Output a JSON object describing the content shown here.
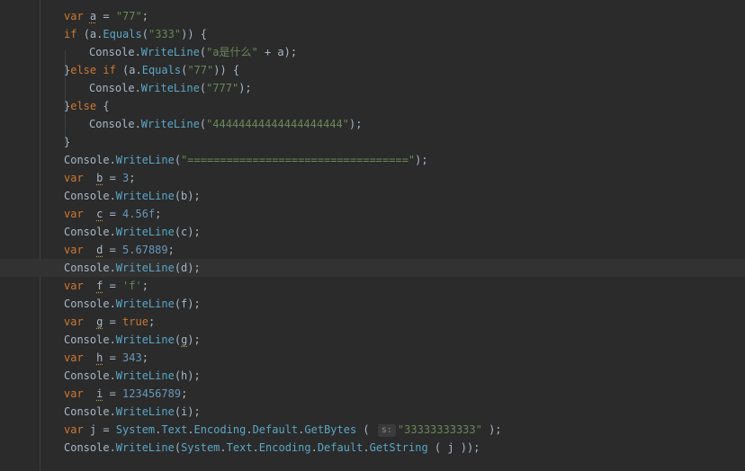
{
  "editor": {
    "lines": [
      {
        "indent": 0,
        "parts": [
          [
            "kw",
            "var "
          ],
          [
            "warn",
            "a"
          ],
          [
            "plain",
            " = "
          ],
          [
            "str",
            "\"77\""
          ],
          [
            "plain",
            ";"
          ]
        ]
      },
      {
        "indent": 0,
        "parts": [
          [
            "kw",
            "if "
          ],
          [
            "plain",
            "(a."
          ],
          [
            "fn",
            "Equals"
          ],
          [
            "plain",
            "("
          ],
          [
            "str",
            "\"333\""
          ],
          [
            "plain",
            ")) {"
          ]
        ]
      },
      {
        "indent": 1,
        "parts": [
          [
            "plain",
            "Console."
          ],
          [
            "fn",
            "WriteLine"
          ],
          [
            "plain",
            "("
          ],
          [
            "str",
            "\"a是什么\""
          ],
          [
            "plain",
            " + a);"
          ]
        ]
      },
      {
        "indent": 0,
        "parts": [
          [
            "plain",
            "}"
          ],
          [
            "kw",
            "else if "
          ],
          [
            "plain",
            "(a."
          ],
          [
            "fn",
            "Equals"
          ],
          [
            "plain",
            "("
          ],
          [
            "str",
            "\"77\""
          ],
          [
            "plain",
            ")) {"
          ]
        ]
      },
      {
        "indent": 1,
        "parts": [
          [
            "plain",
            "Console."
          ],
          [
            "fn",
            "WriteLine"
          ],
          [
            "plain",
            "("
          ],
          [
            "str",
            "\"777\""
          ],
          [
            "plain",
            ");"
          ]
        ]
      },
      {
        "indent": 0,
        "parts": [
          [
            "plain",
            "}"
          ],
          [
            "kw",
            "else "
          ],
          [
            "plain",
            "{"
          ]
        ]
      },
      {
        "indent": 1,
        "parts": [
          [
            "plain",
            "Console."
          ],
          [
            "fn",
            "WriteLine"
          ],
          [
            "plain",
            "("
          ],
          [
            "str",
            "\"44444444444444444444\""
          ],
          [
            "plain",
            ");"
          ]
        ]
      },
      {
        "indent": 0,
        "parts": [
          [
            "plain",
            "}"
          ]
        ]
      },
      {
        "indent": 0,
        "parts": [
          [
            "plain",
            "Console."
          ],
          [
            "fn",
            "WriteLine"
          ],
          [
            "plain",
            "("
          ],
          [
            "str",
            "\"==================================\""
          ],
          [
            "plain",
            ");"
          ]
        ]
      },
      {
        "indent": 0,
        "parts": [
          [
            "kw",
            "var  "
          ],
          [
            "warn",
            "b"
          ],
          [
            "plain",
            " = "
          ],
          [
            "num",
            "3"
          ],
          [
            "plain",
            ";"
          ]
        ]
      },
      {
        "indent": 0,
        "parts": [
          [
            "plain",
            "Console."
          ],
          [
            "fn",
            "WriteLine"
          ],
          [
            "plain",
            "(b);"
          ]
        ]
      },
      {
        "indent": 0,
        "parts": [
          [
            "kw",
            "var  "
          ],
          [
            "warn",
            "c"
          ],
          [
            "plain",
            " = "
          ],
          [
            "num",
            "4.56f"
          ],
          [
            "plain",
            ";"
          ]
        ]
      },
      {
        "indent": 0,
        "parts": [
          [
            "plain",
            "Console."
          ],
          [
            "fn",
            "WriteLine"
          ],
          [
            "plain",
            "(c);"
          ]
        ]
      },
      {
        "indent": 0,
        "parts": [
          [
            "kw",
            "var  "
          ],
          [
            "warn",
            "d"
          ],
          [
            "plain",
            " = "
          ],
          [
            "num",
            "5.67889"
          ],
          [
            "plain",
            ";"
          ]
        ]
      },
      {
        "indent": 0,
        "current": true,
        "parts": [
          [
            "plain",
            "Console."
          ],
          [
            "fn",
            "WriteLine"
          ],
          [
            "plain",
            "(d);"
          ]
        ]
      },
      {
        "indent": 0,
        "parts": [
          [
            "kw",
            "var  "
          ],
          [
            "warn",
            "f"
          ],
          [
            "plain",
            " = "
          ],
          [
            "str",
            "'f'"
          ],
          [
            "plain",
            ";"
          ]
        ]
      },
      {
        "indent": 0,
        "parts": [
          [
            "plain",
            "Console."
          ],
          [
            "fn",
            "WriteLine"
          ],
          [
            "plain",
            "(f);"
          ]
        ]
      },
      {
        "indent": 0,
        "parts": [
          [
            "kw",
            "var  "
          ],
          [
            "warn",
            "g"
          ],
          [
            "plain",
            " = "
          ],
          [
            "kw",
            "true"
          ],
          [
            "plain",
            ";"
          ]
        ]
      },
      {
        "indent": 0,
        "parts": [
          [
            "plain",
            "Console."
          ],
          [
            "fn",
            "WriteLine"
          ],
          [
            "plain",
            "("
          ],
          [
            "warn",
            "g"
          ],
          [
            "plain",
            ");"
          ]
        ]
      },
      {
        "indent": 0,
        "parts": [
          [
            "kw",
            "var  "
          ],
          [
            "warn",
            "h"
          ],
          [
            "plain",
            " = "
          ],
          [
            "num",
            "343"
          ],
          [
            "plain",
            ";"
          ]
        ]
      },
      {
        "indent": 0,
        "parts": [
          [
            "plain",
            "Console."
          ],
          [
            "fn",
            "WriteLine"
          ],
          [
            "plain",
            "(h);"
          ]
        ]
      },
      {
        "indent": 0,
        "parts": [
          [
            "kw",
            "var  "
          ],
          [
            "warn",
            "i"
          ],
          [
            "plain",
            " = "
          ],
          [
            "num",
            "123456789"
          ],
          [
            "plain",
            ";"
          ]
        ]
      },
      {
        "indent": 0,
        "parts": [
          [
            "plain",
            "Console."
          ],
          [
            "fn",
            "WriteLine"
          ],
          [
            "plain",
            "(i);"
          ]
        ]
      },
      {
        "indent": 0,
        "parts": [
          [
            "kw",
            "var "
          ],
          [
            "plain",
            "j = "
          ],
          [
            "fn",
            "System"
          ],
          [
            "plain",
            "."
          ],
          [
            "fn",
            "Text"
          ],
          [
            "plain",
            "."
          ],
          [
            "fn",
            "Encoding"
          ],
          [
            "plain",
            "."
          ],
          [
            "fn",
            "Default"
          ],
          [
            "plain",
            "."
          ],
          [
            "fn",
            "GetBytes"
          ],
          [
            "plain",
            " ( "
          ],
          [
            "hint",
            "s:"
          ],
          [
            "str",
            "\"33333333333\""
          ],
          [
            "plain",
            " );"
          ]
        ]
      },
      {
        "indent": 0,
        "parts": [
          [
            "plain",
            "Console."
          ],
          [
            "fn",
            "WriteLine"
          ],
          [
            "plain",
            "("
          ],
          [
            "fn",
            "System"
          ],
          [
            "plain",
            "."
          ],
          [
            "fn",
            "Text"
          ],
          [
            "plain",
            "."
          ],
          [
            "fn",
            "Encoding"
          ],
          [
            "plain",
            "."
          ],
          [
            "fn",
            "Default"
          ],
          [
            "plain",
            "."
          ],
          [
            "fn",
            "GetString"
          ],
          [
            "plain",
            " ( j ));"
          ]
        ]
      }
    ]
  }
}
